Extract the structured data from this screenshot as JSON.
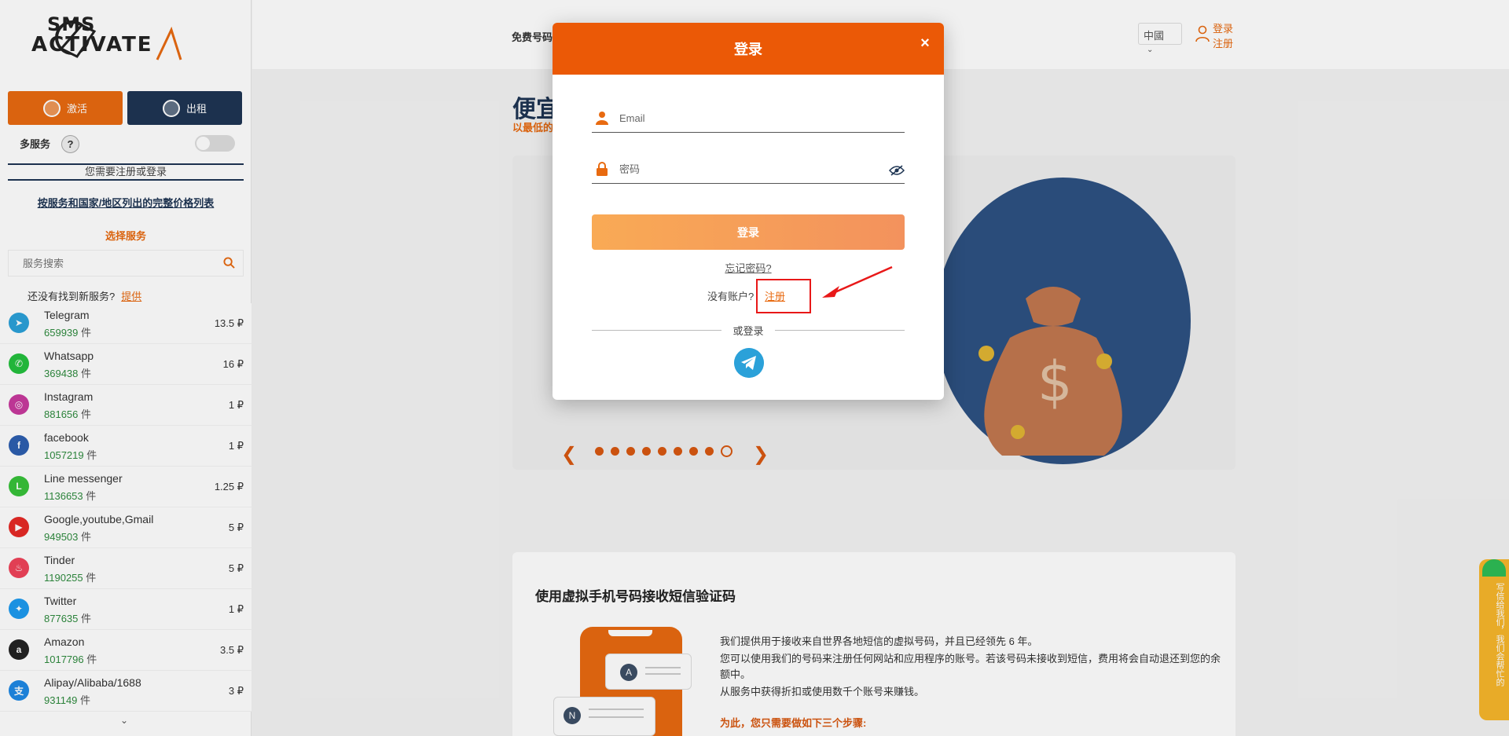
{
  "sidebar": {
    "logo_top": "SMS",
    "logo_bottom": "ACTIVATE",
    "btn_activate": "激活",
    "btn_rent": "出租",
    "multi_service": "多服务",
    "help": "?",
    "need_login": "您需要注册或登录",
    "price_list_link": "按服务和国家/地区列出的完整价格列表",
    "choose_service": "选择服务",
    "search_placeholder": "服务搜索",
    "no_service_text": "还没有找到新服务?",
    "offer_link": "提供",
    "services": [
      {
        "name": "Telegram",
        "count": "659939",
        "unit": "件",
        "price": "13.5 ₽",
        "color": "#2ba1d9",
        "icon": "telegram-icon"
      },
      {
        "name": "Whatsapp",
        "count": "369438",
        "unit": "件",
        "price": "16 ₽",
        "color": "#25c13e",
        "icon": "whatsapp-icon"
      },
      {
        "name": "Instagram",
        "count": "881656",
        "unit": "件",
        "price": "1 ₽",
        "color": "#c83a9e",
        "icon": "instagram-icon"
      },
      {
        "name": "facebook",
        "count": "1057219",
        "unit": "件",
        "price": "1 ₽",
        "color": "#2d5fb0",
        "icon": "facebook-icon"
      },
      {
        "name": "Line messenger",
        "count": "1136653",
        "unit": "件",
        "price": "1.25 ₽",
        "color": "#38c23a",
        "icon": "line-icon"
      },
      {
        "name": "Google,youtube,Gmail",
        "count": "949503",
        "unit": "件",
        "price": "5 ₽",
        "color": "#e62a26",
        "icon": "youtube-icon"
      },
      {
        "name": "Tinder",
        "count": "1190255",
        "unit": "件",
        "price": "5 ₽",
        "color": "#f0435a",
        "icon": "tinder-icon"
      },
      {
        "name": "Twitter",
        "count": "877635",
        "unit": "件",
        "price": "1 ₽",
        "color": "#1d9bf0",
        "icon": "twitter-icon"
      },
      {
        "name": "Amazon",
        "count": "1017796",
        "unit": "件",
        "price": "3.5 ₽",
        "color": "#222222",
        "icon": "amazon-icon"
      },
      {
        "name": "Alipay/Alibaba/1688",
        "count": "931149",
        "unit": "件",
        "price": "3 ₽",
        "color": "#1e88e5",
        "icon": "alipay-icon"
      }
    ]
  },
  "header": {
    "nav_free": "免费号码",
    "lang": "中國",
    "login": "登录",
    "register": "注册"
  },
  "main": {
    "hero_title": "便宜",
    "hero_sub": "以最低的",
    "info_title": "使用虚拟手机号码接收短信验证码",
    "info_lines": [
      "我们提供用于接收来自世界各地短信的虚拟号码，并且已经领先 6 年。",
      "您可以使用我们的号码来注册任何网站和应用程序的账号。若该号码未接收到短信，费用将会自动退还到您的余额中。",
      "从服务中获得折扣或使用数千个账号来赚钱。"
    ],
    "steps_title": "为此，您只需要做如下三个步骤:",
    "bubble_a": "A",
    "bubble_n": "N",
    "feedback": "写信给我们，我们会帮忙的"
  },
  "modal": {
    "title": "登录",
    "close": "×",
    "email_placeholder": "Email",
    "password_placeholder": "密码",
    "login_button": "登录",
    "forgot": "忘记密码?",
    "no_account": "没有账户?",
    "register": "注册",
    "or_login": "或登录"
  },
  "colors": {
    "brand_orange": "#eb5906",
    "navy": "#1e3553",
    "highlight_red": "#e81818"
  }
}
